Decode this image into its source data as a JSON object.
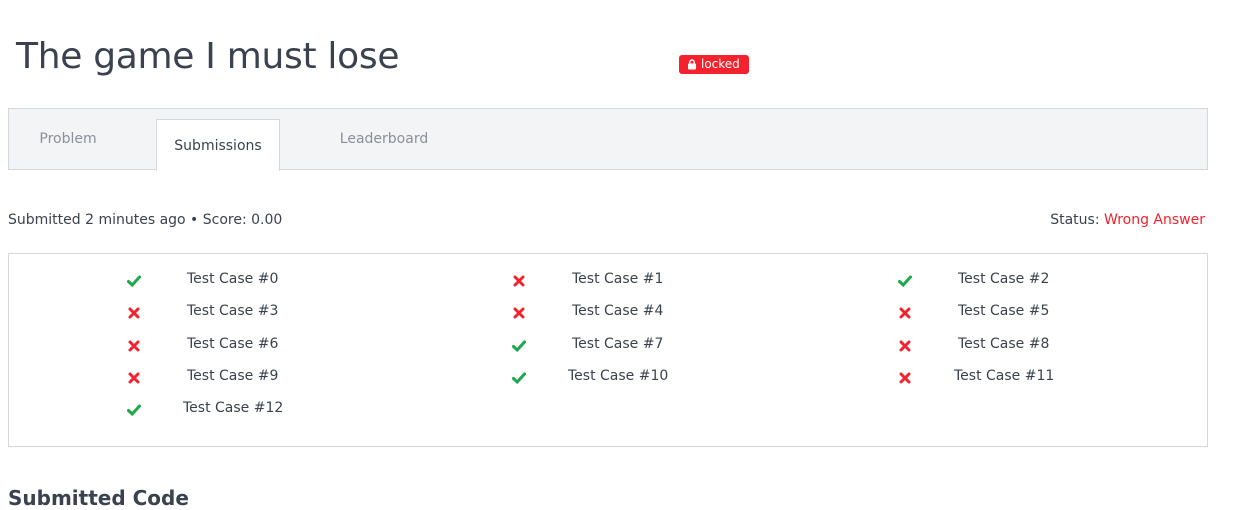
{
  "problem": {
    "title": "The game I must lose",
    "badge_label": "locked",
    "badge_color": "#f4222d"
  },
  "tabs": [
    {
      "label": "Problem",
      "active": false
    },
    {
      "label": "Submissions",
      "active": true
    },
    {
      "label": "Leaderboard",
      "active": false
    }
  ],
  "submission": {
    "meta": "Submitted 2 minutes ago • Score: 0.00",
    "status_label": "Status:",
    "status_value": "Wrong Answer",
    "status_color": "#f4222d"
  },
  "test_cases": [
    {
      "label": "Test Case #0",
      "passed": true
    },
    {
      "label": "Test Case #1",
      "passed": false
    },
    {
      "label": "Test Case #2",
      "passed": true
    },
    {
      "label": "Test Case #3",
      "passed": false
    },
    {
      "label": "Test Case #4",
      "passed": false
    },
    {
      "label": "Test Case #5",
      "passed": false
    },
    {
      "label": "Test Case #6",
      "passed": false
    },
    {
      "label": "Test Case #7",
      "passed": true
    },
    {
      "label": "Test Case #8",
      "passed": false
    },
    {
      "label": "Test Case #9",
      "passed": false
    },
    {
      "label": "Test Case #10",
      "passed": true
    },
    {
      "label": "Test Case #11",
      "passed": false
    },
    {
      "label": "Test Case #12",
      "passed": true
    }
  ],
  "icons": {
    "pass": "check-icon",
    "fail": "cross-icon",
    "pass_color": "#1ba94c",
    "fail_color": "#f4222d"
  },
  "section": {
    "heading": "Submitted Code"
  }
}
